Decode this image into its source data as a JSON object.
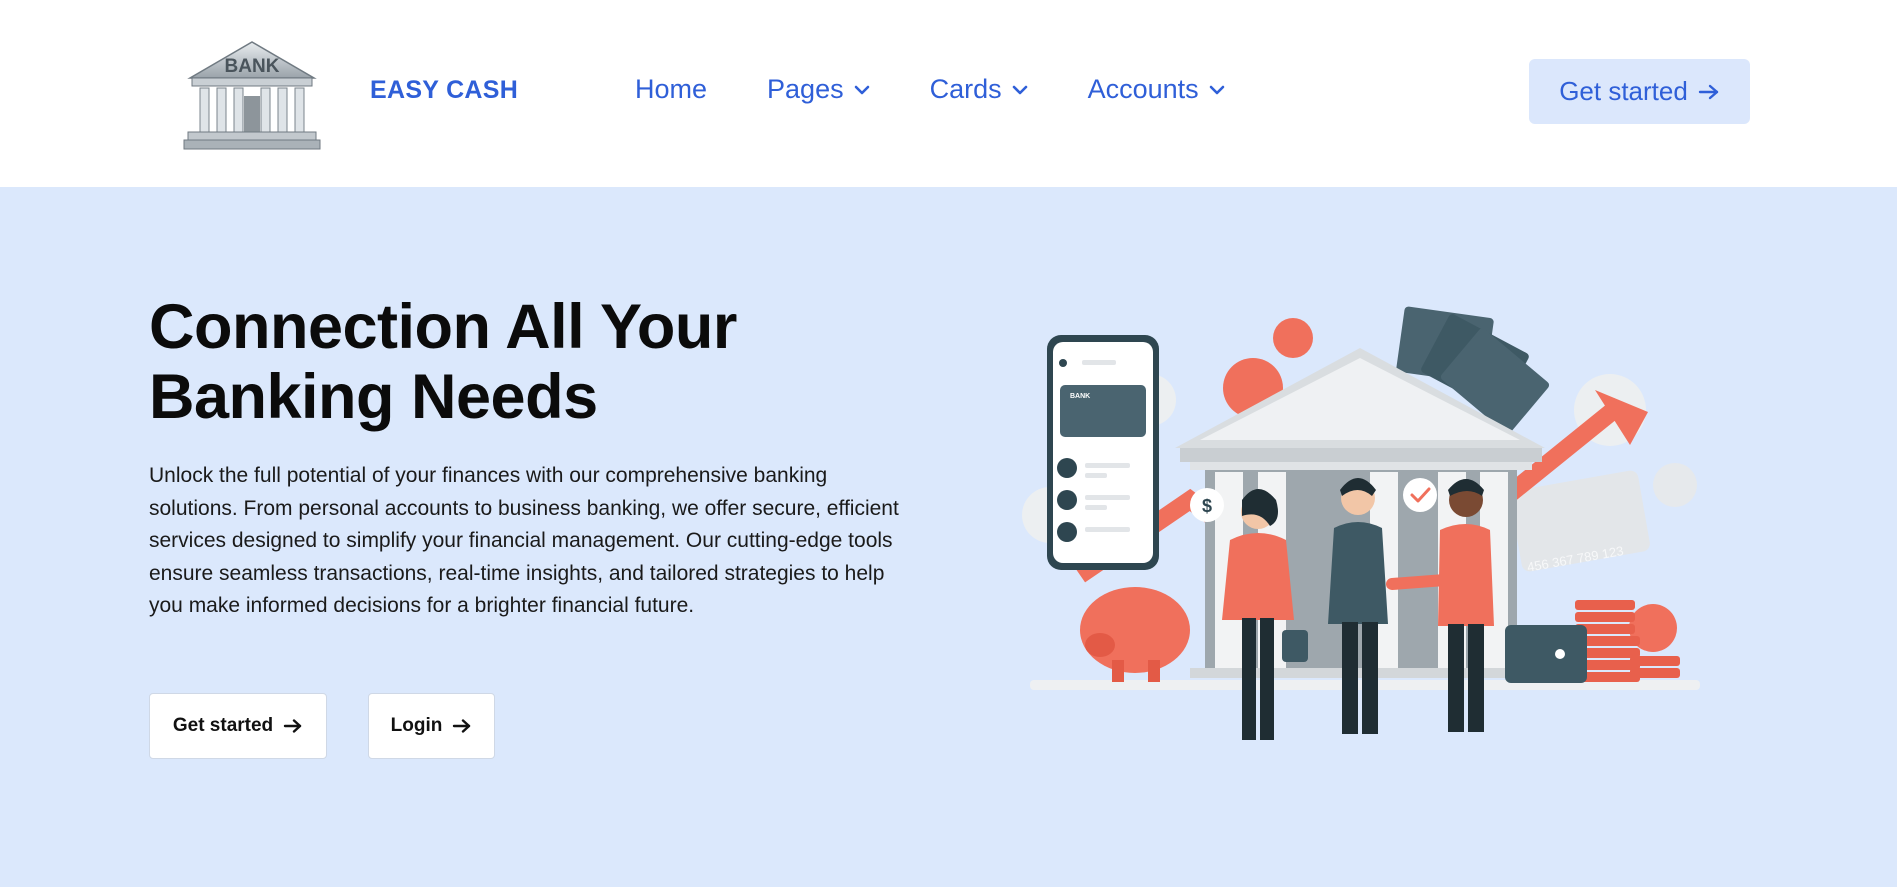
{
  "header": {
    "logo_text": "BANK",
    "brand": "EASY CASH",
    "nav": [
      {
        "label": "Home",
        "has_dropdown": false
      },
      {
        "label": "Pages",
        "has_dropdown": true
      },
      {
        "label": "Cards",
        "has_dropdown": true
      },
      {
        "label": "Accounts",
        "has_dropdown": true
      }
    ],
    "cta_label": "Get started"
  },
  "hero": {
    "title_line1": "Connection All Your",
    "title_line2": "Banking Needs",
    "description": "Unlock the full potential of your finances with our comprehensive banking solutions. From personal accounts to business banking, we offer secure, efficient services designed to simplify your financial management. Our cutting-edge tools ensure seamless transactions, real-time insights, and tailored strategies to help you make informed decisions for a brighter financial future.",
    "primary_button": "Get started",
    "secondary_button": "Login"
  },
  "illustration": {
    "phone_card_label": "BANK",
    "card_number": "456 367 789 123",
    "icons": [
      "dollar-coin-icon",
      "checkmark-icon",
      "cart-icon"
    ]
  },
  "colors": {
    "brand_blue": "#2f5fd8",
    "hero_bg": "#dbe8fc",
    "accent_coral": "#f0705c",
    "dark_slate": "#2e4650"
  }
}
